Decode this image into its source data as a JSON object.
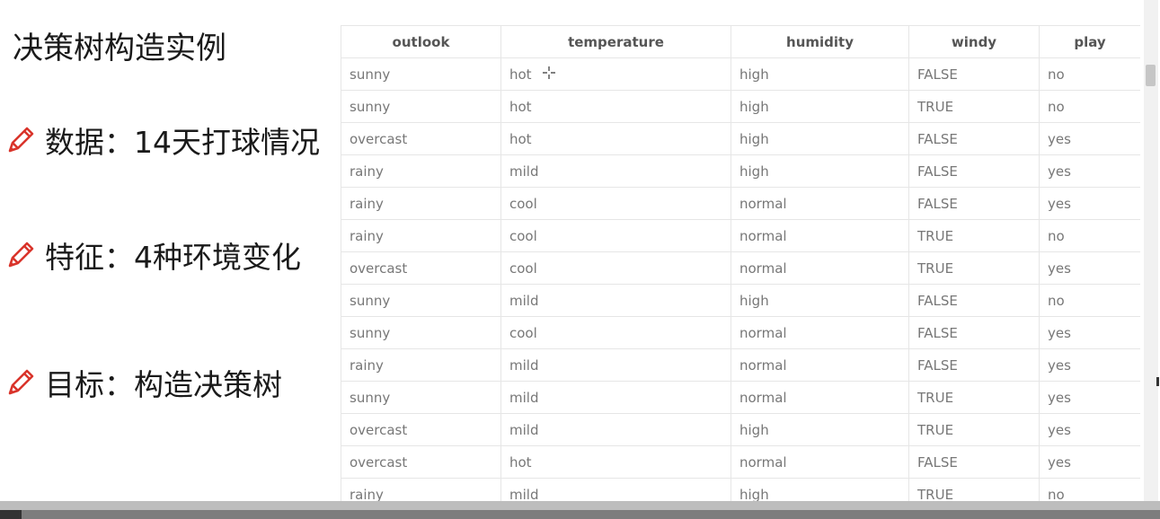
{
  "slide": {
    "title": "决策树构造实例",
    "bullets": [
      {
        "icon": "pencil-icon",
        "text": "数据：14天打球情况"
      },
      {
        "icon": "pencil-icon",
        "text": "特征：4种环境变化"
      },
      {
        "icon": "pencil-icon",
        "text": "目标：构造决策树"
      }
    ]
  },
  "table": {
    "headers": [
      "outlook",
      "temperature",
      "humidity",
      "windy",
      "play"
    ],
    "rows": [
      [
        "sunny",
        "hot",
        "high",
        "FALSE",
        "no"
      ],
      [
        "sunny",
        "hot",
        "high",
        "TRUE",
        "no"
      ],
      [
        "overcast",
        "hot",
        "high",
        "FALSE",
        "yes"
      ],
      [
        "rainy",
        "mild",
        "high",
        "FALSE",
        "yes"
      ],
      [
        "rainy",
        "cool",
        "normal",
        "FALSE",
        "yes"
      ],
      [
        "rainy",
        "cool",
        "normal",
        "TRUE",
        "no"
      ],
      [
        "overcast",
        "cool",
        "normal",
        "TRUE",
        "yes"
      ],
      [
        "sunny",
        "mild",
        "high",
        "FALSE",
        "no"
      ],
      [
        "sunny",
        "cool",
        "normal",
        "FALSE",
        "yes"
      ],
      [
        "rainy",
        "mild",
        "normal",
        "FALSE",
        "yes"
      ],
      [
        "sunny",
        "mild",
        "normal",
        "TRUE",
        "yes"
      ],
      [
        "overcast",
        "mild",
        "high",
        "TRUE",
        "yes"
      ],
      [
        "overcast",
        "hot",
        "normal",
        "FALSE",
        "yes"
      ],
      [
        "rainy",
        "mild",
        "high",
        "TRUE",
        "no"
      ]
    ]
  },
  "colors": {
    "pencil_icon": "#d9342b",
    "header_text": "#555555",
    "cell_text": "#777777",
    "grid": "#e6e6e6"
  }
}
